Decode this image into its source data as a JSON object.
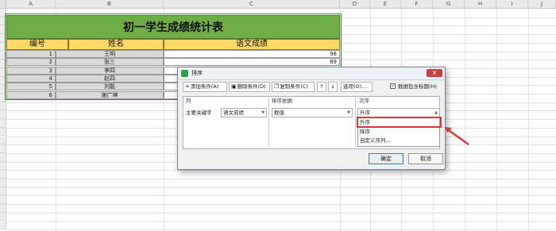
{
  "spreadsheet": {
    "columns": [
      "A",
      "B",
      "C",
      "D",
      "E",
      "F",
      "G",
      "H",
      "I",
      "J"
    ],
    "rows": [
      "1",
      "2",
      "3",
      "4",
      "5",
      "6",
      "7",
      "8",
      "9",
      "10",
      "11",
      "12",
      "13",
      "14",
      "15",
      "16",
      "17",
      "18",
      "19",
      "20",
      "21",
      "22",
      "23",
      "24",
      "25",
      "26"
    ],
    "table_title": "初一学生成绩统计表",
    "headers": [
      "编号",
      "姓名",
      "语文成绩"
    ],
    "data_rows": [
      {
        "id": "1",
        "name": "王明",
        "score": "98"
      },
      {
        "id": "2",
        "name": "张三",
        "score": "89"
      },
      {
        "id": "3",
        "name": "李四",
        "score": ""
      },
      {
        "id": "4",
        "name": "赵四",
        "score": ""
      },
      {
        "id": "5",
        "name": "刘能",
        "score": ""
      },
      {
        "id": "6",
        "name": "谢广坤",
        "score": ""
      }
    ]
  },
  "dialog": {
    "title": "排序",
    "close_label": "×",
    "toolbar": {
      "add_label": "添加条件(A)",
      "delete_label": "删除条件(D)",
      "copy_label": "复制条件(C)",
      "up_label": "↑",
      "down_label": "↓",
      "options_label": "选项(O)...",
      "header_checkbox_label": "数据包含标题(H)",
      "header_checked": true
    },
    "col_header": "列",
    "basis_header": "排序依据",
    "order_header": "次序",
    "row_label": "主要关键字",
    "column_value": "语文成绩",
    "basis_value": "数值",
    "order_value": "升序",
    "order_options": [
      "升序",
      "降序",
      "自定义序列..."
    ],
    "ok_label": "确定",
    "cancel_label": "取消"
  },
  "colors": {
    "title_bg": "#70ad47",
    "header_bg": "#ffd966",
    "highlight": "#d9383a"
  }
}
